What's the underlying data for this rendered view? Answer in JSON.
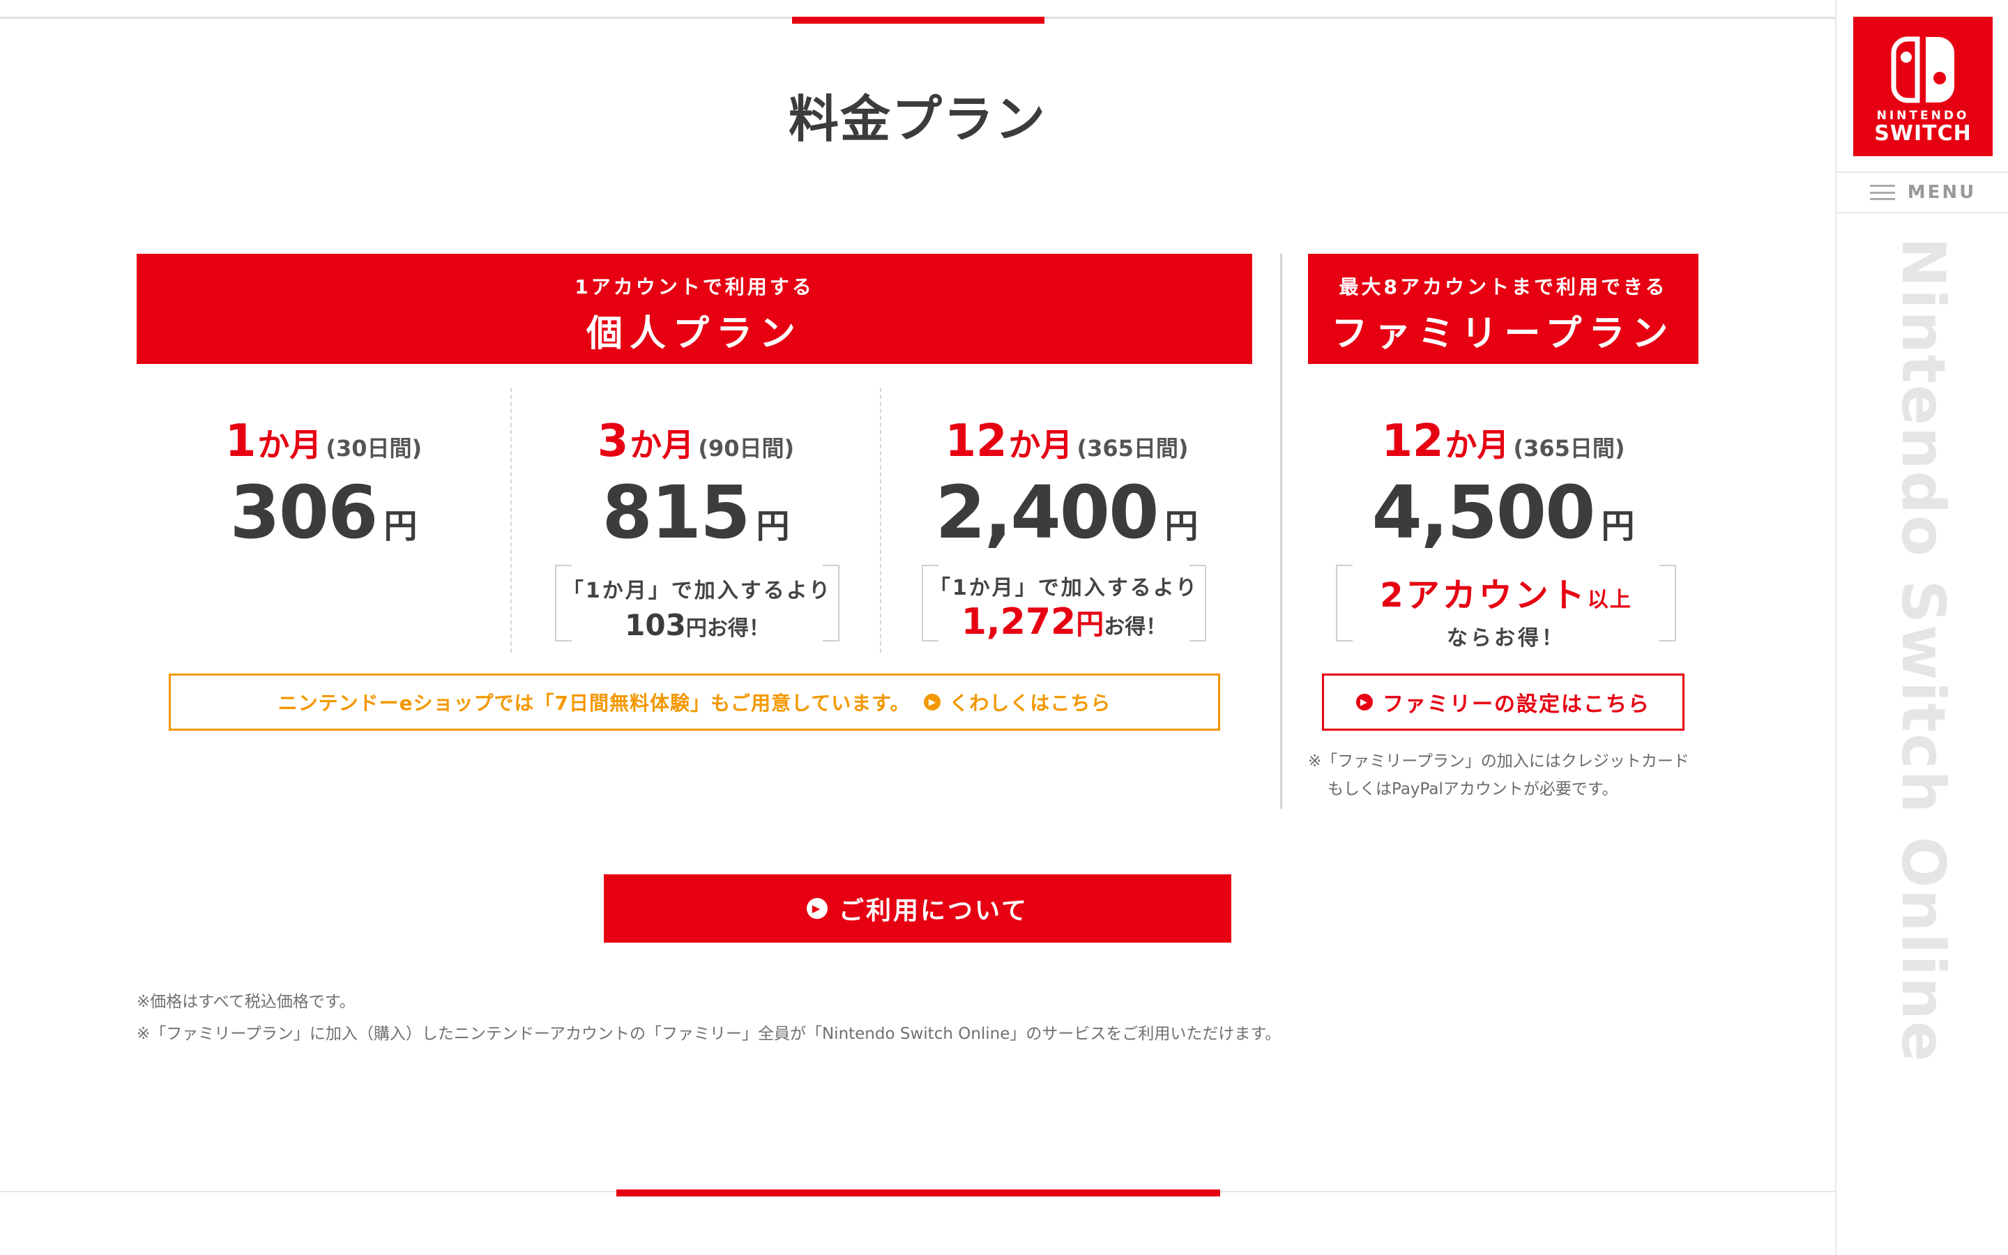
{
  "page": {
    "title": "料金プラン"
  },
  "individual": {
    "banner_sub": "1アカウントで利用する",
    "banner_title": "個人プラン",
    "plans": [
      {
        "period_num": "1",
        "period_unit": "か月",
        "days": "(30日間)",
        "price": "306",
        "yen": "円"
      },
      {
        "period_num": "3",
        "period_unit": "か月",
        "days": "(90日間)",
        "price": "815",
        "yen": "円",
        "note_line1": "「1か月」で加入するより",
        "note_amount": "103",
        "note_yen": "円",
        "note_suffix": "お得！"
      },
      {
        "period_num": "12",
        "period_unit": "か月",
        "days": "(365日間)",
        "price": "2,400",
        "yen": "円",
        "note_line1": "「1か月」で加入するより",
        "note_amount": "1,272",
        "note_yen": "円",
        "note_suffix": "お得！"
      }
    ],
    "trial_text": "ニンテンドーeショップでは「7日間無料体験」もご用意しています。",
    "trial_link": "くわしくはこちら"
  },
  "family": {
    "banner_sub": "最大8アカウントまで利用できる",
    "banner_title": "ファミリープラン",
    "period_num": "12",
    "period_unit": "か月",
    "days": "(365日間)",
    "price": "4,500",
    "yen": "円",
    "note_big": "2アカウント",
    "note_small": "以上",
    "note_line2": "ならお得！",
    "settings_link": "ファミリーの設定はこちら",
    "disclaimer_line1": "※「ファミリープラン」の加入にはクレジットカード",
    "disclaimer_line2": "もしくはPayPalアカウントが必要です。"
  },
  "cta": {
    "label": "ご利用について"
  },
  "footnotes": [
    "※価格はすべて税込価格です。",
    "※「ファミリープラン」に加入（購入）したニンテンドーアカウントの「ファミリー」全員が「Nintendo Switch Online」のサービスをご利用いただけます。"
  ],
  "sidebar": {
    "brand_line1": "NINTENDO",
    "brand_line2": "SWITCH",
    "menu_label": "MENU",
    "vertical_text": "Nintendo Switch Online"
  },
  "colors": {
    "accent": "#e60012",
    "orange": "#f39800",
    "text": "#3c3c3c",
    "muted": "#707070"
  },
  "icons": {
    "menu": "hamburger-icon",
    "arrow": "circle-chevron-right-icon",
    "logo": "nintendo-switch-logo"
  }
}
